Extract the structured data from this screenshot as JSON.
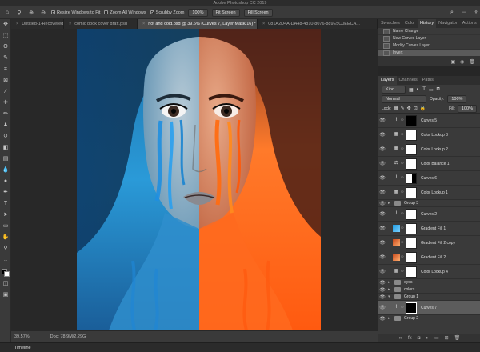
{
  "app": {
    "title": "Adobe Photoshop CC 2019"
  },
  "options_bar": {
    "resize_windows": "Resize Windows to Fit",
    "zoom_all": "Zoom All Windows",
    "scrubby_zoom": "Scrubby Zoom",
    "zoom_value": "100%",
    "fit_screen": "Fit Screen",
    "fill_screen": "Fill Screen"
  },
  "doc_tabs": [
    {
      "label": "Untitled-1-Recovered"
    },
    {
      "label": "comic book cover draft.psd"
    },
    {
      "label": "hot and cold.psd @ 39.6% (Curves 7, Layer Mask/16) *"
    },
    {
      "label": "081A2D4A-DA48-4810-8076-889E5C0EECA..."
    }
  ],
  "status": {
    "zoom": "39.57%",
    "doc": "Doc: 78.9M/2.29G"
  },
  "timeline_label": "Timeline",
  "history_panel": {
    "tabs": [
      "Swatches",
      "Color",
      "History",
      "Navigator",
      "Actions"
    ],
    "items": [
      {
        "label": "Name Change"
      },
      {
        "label": "New Curves Layer"
      },
      {
        "label": "Modify Curves Layer"
      },
      {
        "label": "Invert"
      }
    ]
  },
  "layers_panel": {
    "tabs": [
      "Layers",
      "Channels",
      "Paths"
    ],
    "kind_label": "Kind",
    "blend_mode": "Normal",
    "opacity_label": "Opacity:",
    "opacity_value": "100%",
    "lock_label": "Lock:",
    "fill_label": "Fill:",
    "fill_value": "100%",
    "layers": [
      {
        "name": "Curves 5"
      },
      {
        "name": "Color Lookup 3"
      },
      {
        "name": "Color Lookup 2"
      },
      {
        "name": "Color Balance 1"
      },
      {
        "name": "Curves 6"
      },
      {
        "name": "Color Lookup 1"
      },
      {
        "name": "Group 3"
      },
      {
        "name": "Curves 2"
      },
      {
        "name": "Gradient Fill 1"
      },
      {
        "name": "Gradient Fill 2 copy"
      },
      {
        "name": "Gradient Fill 2"
      },
      {
        "name": "Color Lookup 4"
      },
      {
        "name": "eyes"
      },
      {
        "name": "colors"
      },
      {
        "name": "Group 1"
      },
      {
        "name": "Curves 7"
      },
      {
        "name": "Group 2"
      }
    ]
  },
  "colors": {
    "cold": "#2a9ad8",
    "hot": "#ff6a1a",
    "ui_bg": "#535353",
    "panel_bg": "#3a3a3a"
  }
}
